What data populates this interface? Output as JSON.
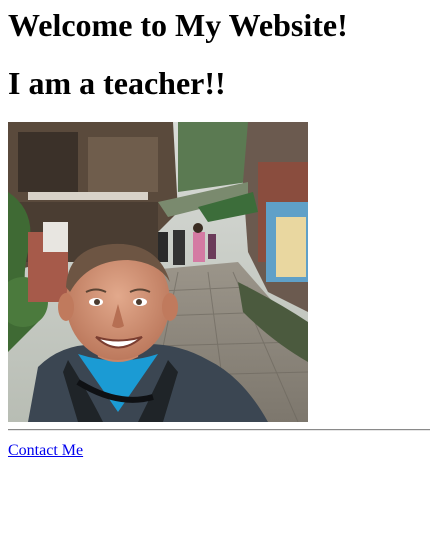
{
  "page": {
    "heading": "Welcome to My Website!",
    "subheading": "I am a teacher!!",
    "contact_link": "Contact Me"
  },
  "colors": {
    "link": "#0000ee",
    "divider": "#8a8a8a"
  }
}
